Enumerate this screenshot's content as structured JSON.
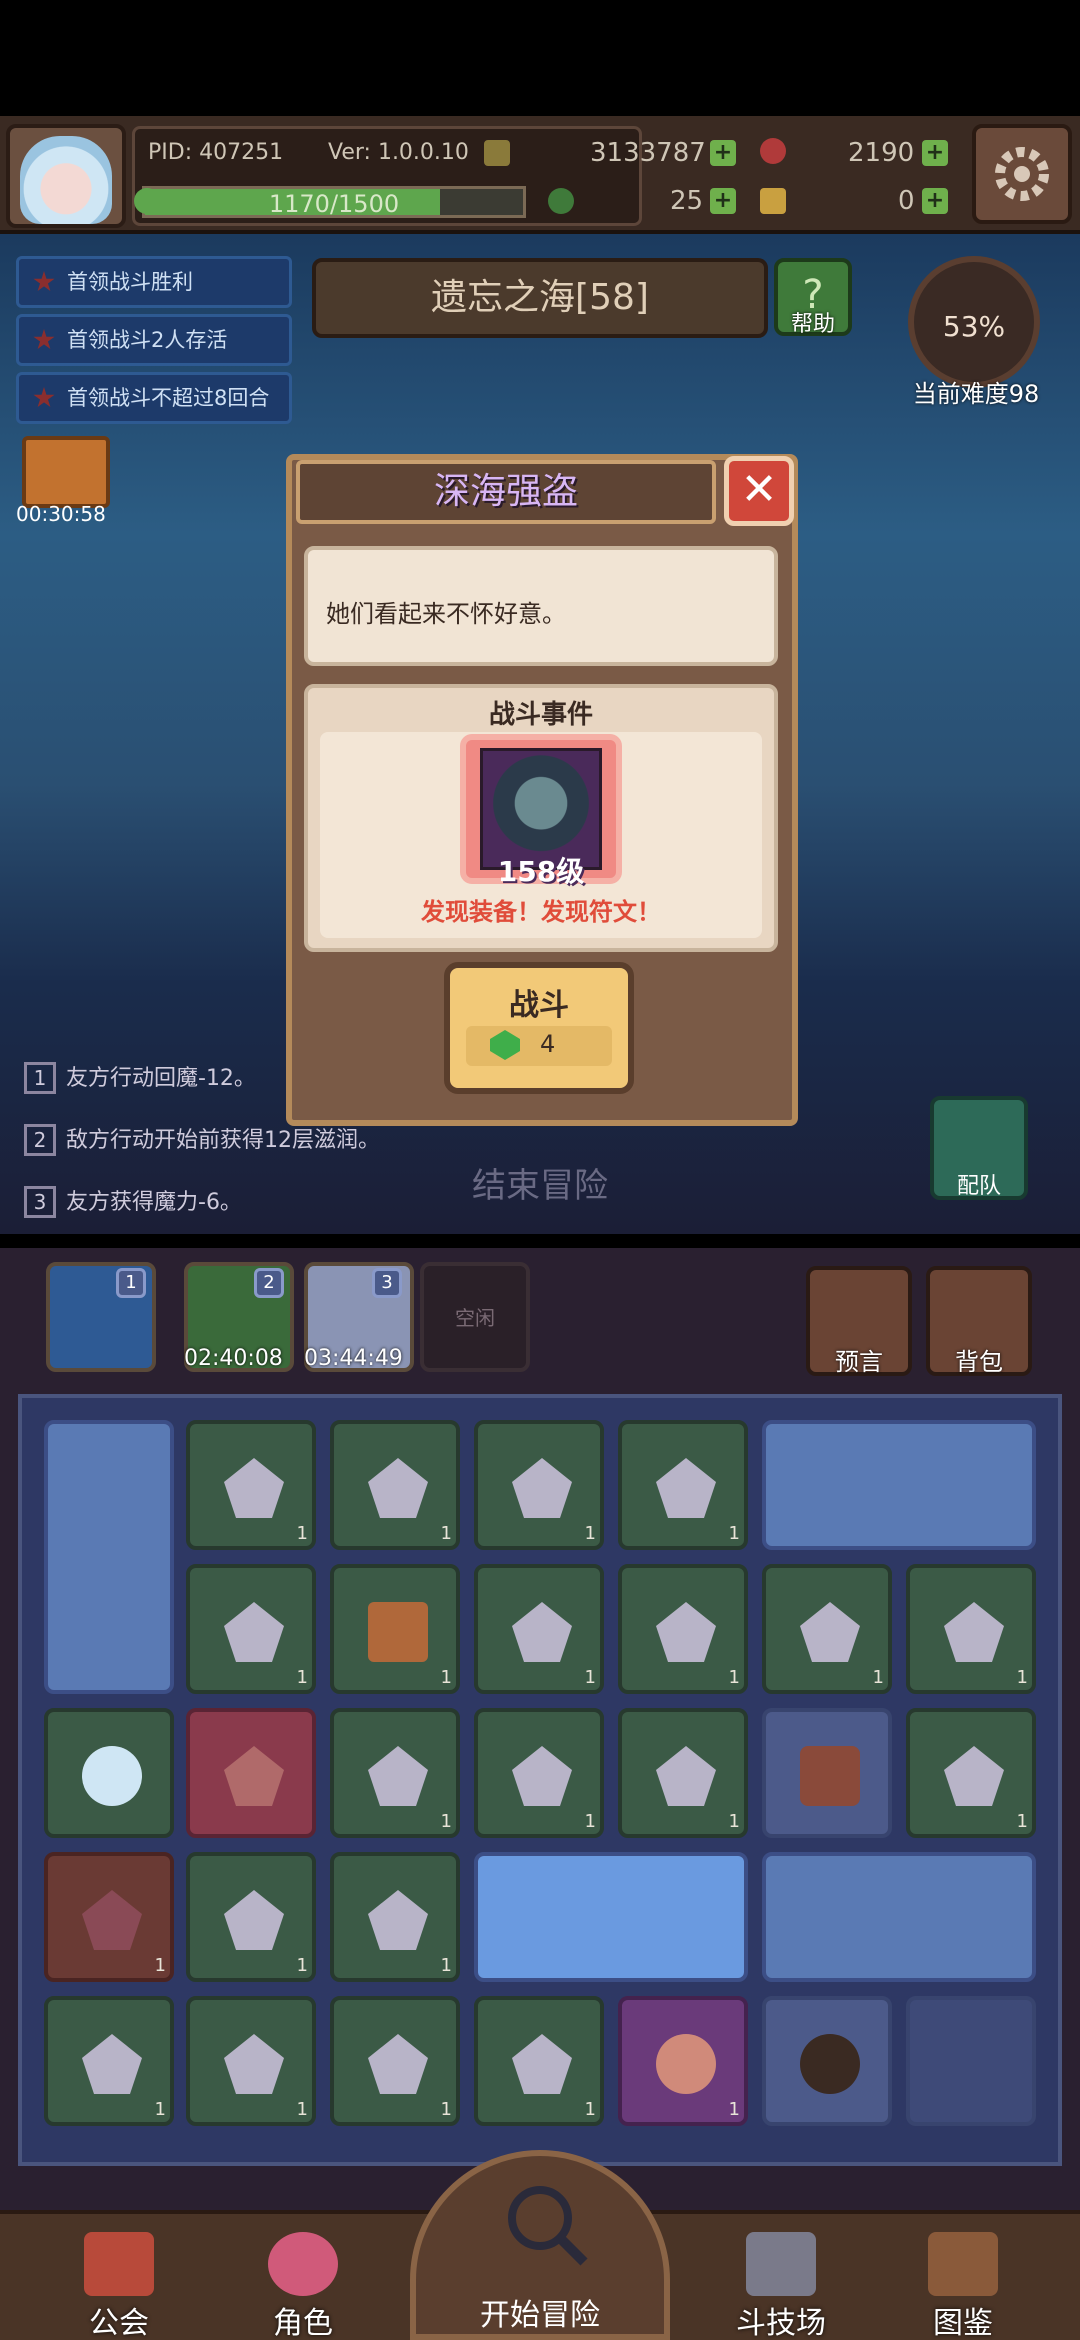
{
  "header": {
    "pid": "PID: 407251",
    "version": "Ver: 1.0.0.10",
    "gold": "3133787",
    "gems": "2190",
    "xp": "1170/1500",
    "xp_fraction": 0.78,
    "clover": "25",
    "keys": "0",
    "colors": {
      "accent_green": "#6fb04c",
      "gem_red": "#d0473a"
    }
  },
  "quests": [
    "首领战斗胜利",
    "首领战斗2人存活",
    "首领战斗不超过8回合"
  ],
  "stage": {
    "title": "遗忘之海[58]",
    "help_label": "帮助",
    "difficulty_pct": "53%",
    "difficulty_label": "当前难度98",
    "gift_timer": "00:30:58"
  },
  "log": [
    {
      "num": "1",
      "text": "友方行动回魔-12。"
    },
    {
      "num": "2",
      "text": "敌方行动开始前获得12层滋润。"
    },
    {
      "num": "3",
      "text": "友方获得魔力-6。"
    }
  ],
  "end_adventure": "结束冒险",
  "team_label": "配队",
  "modal": {
    "title": "深海强盗",
    "description": "她们看起来不怀好意。",
    "event_title": "战斗事件",
    "enemy_level": "158级",
    "discover": "发现装备！发现符文！",
    "fight_label": "战斗",
    "fight_cost": "4"
  },
  "slots": [
    {
      "badge": "1",
      "timer": ""
    },
    {
      "badge": "2",
      "timer": "02:40:08"
    },
    {
      "badge": "3",
      "timer": "03:44:49"
    },
    {
      "badge": "",
      "timer": "",
      "label": "空闲"
    }
  ],
  "side_buttons": {
    "prophecy": "预言",
    "backpack": "背包"
  },
  "grid_count": "1",
  "nav": {
    "guild": "公会",
    "character": "角色",
    "start": "开始冒险",
    "arena": "斗技场",
    "codex": "图鉴"
  }
}
